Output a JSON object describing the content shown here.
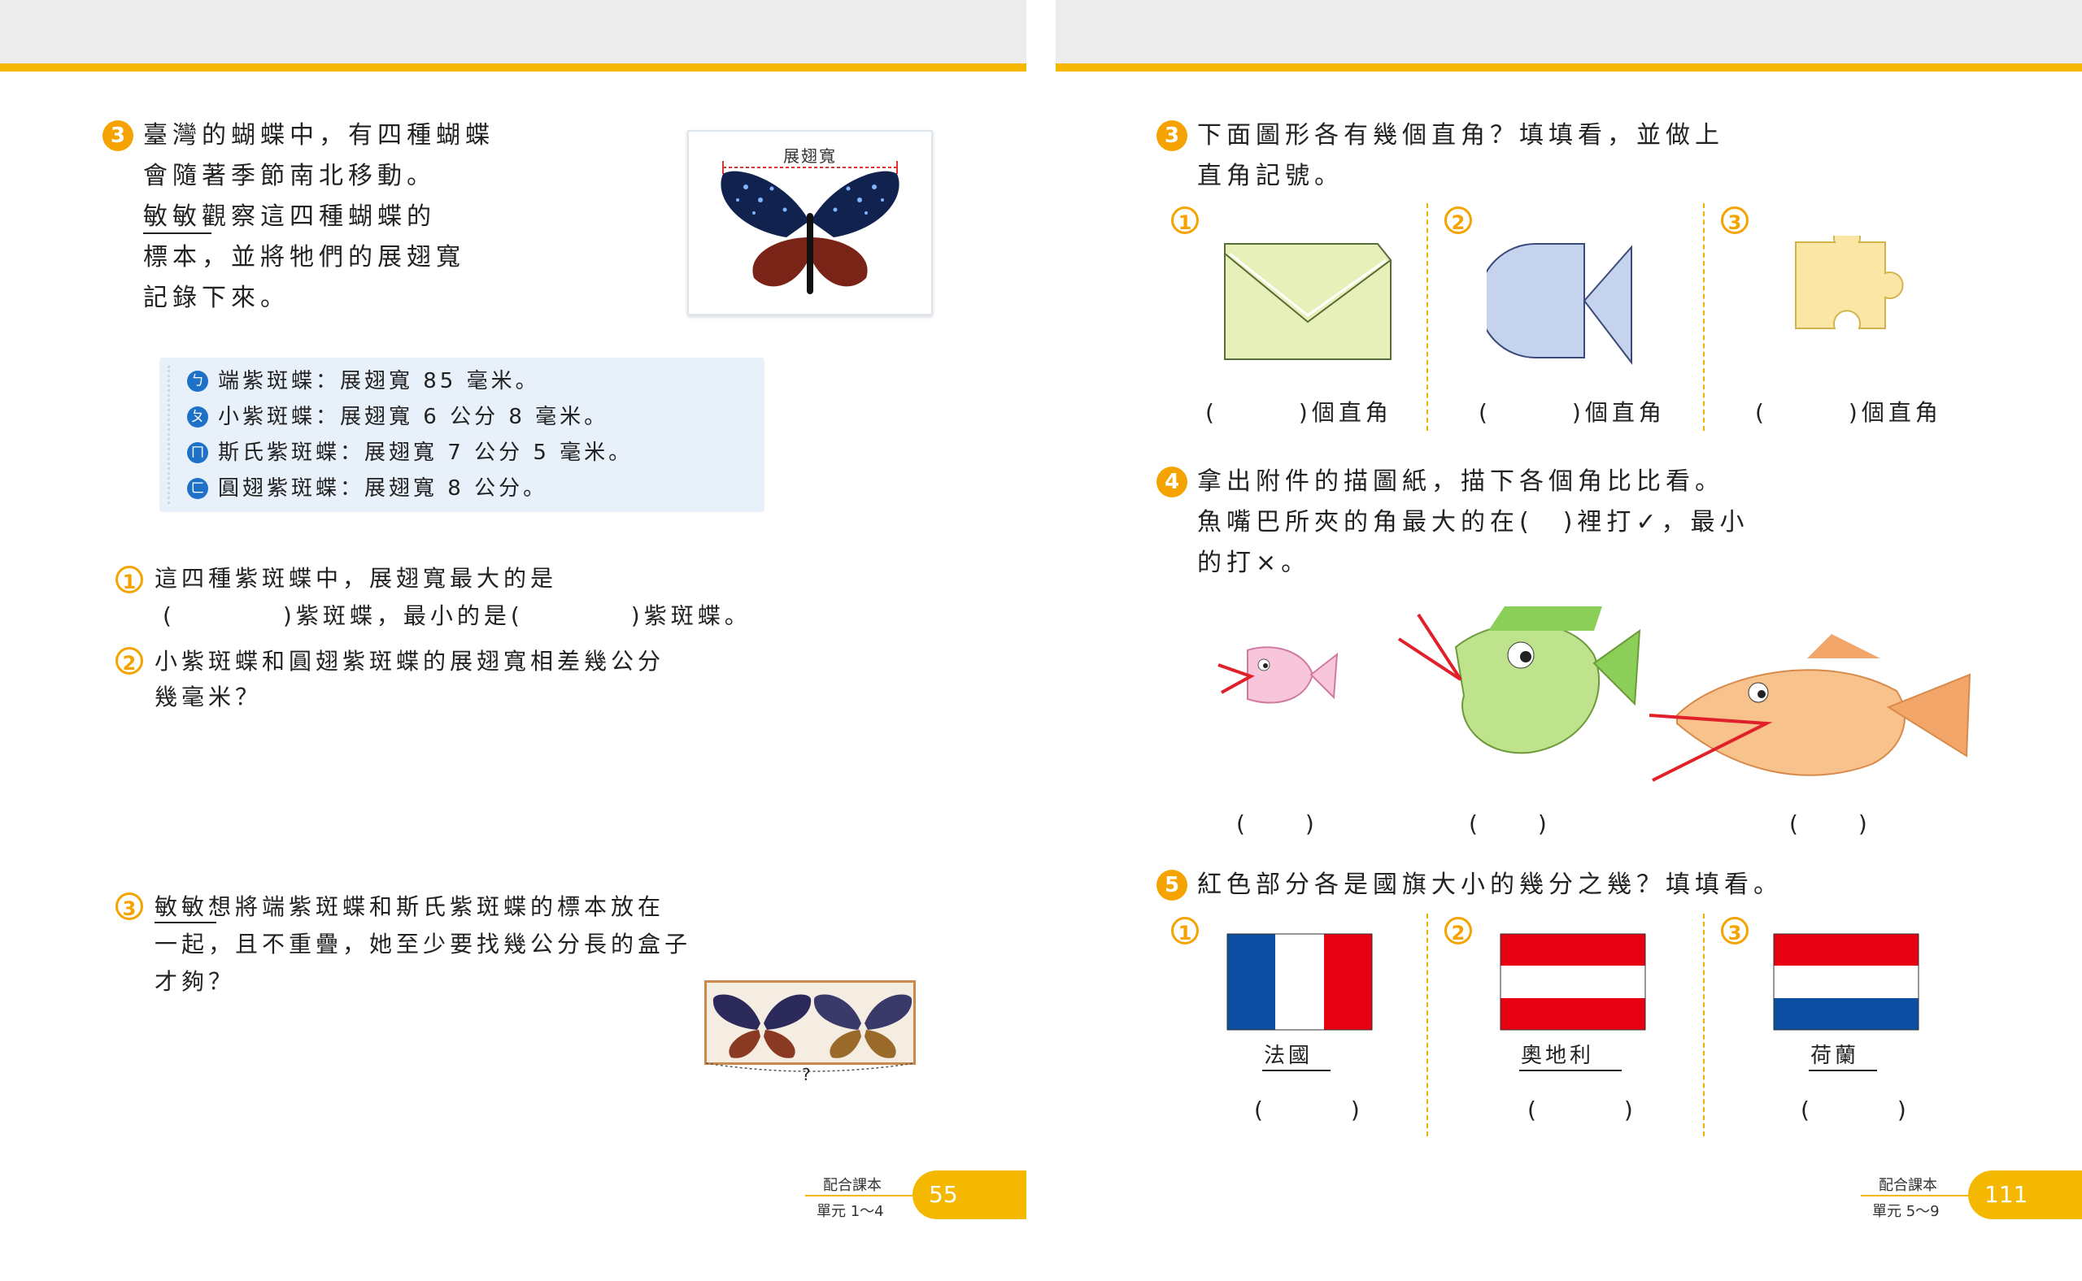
{
  "left": {
    "q3": {
      "num": "3",
      "line1": "臺灣的蝴蝶中，有四種蝴蝶",
      "line2": "會隨著季節南北移動。",
      "line3": "敏敏觀察這四種蝴蝶的",
      "line4": "標本，並將牠們的展翅寬",
      "line5": "記錄下來。"
    },
    "photo_label": "展翅寬",
    "panel": {
      "items": [
        {
          "bullet": "ㄅ",
          "text": "端紫斑蝶：展翅寬 85 毫米。"
        },
        {
          "bullet": "ㄆ",
          "text": "小紫斑蝶：展翅寬 6 公分 8 毫米。"
        },
        {
          "bullet": "ㄇ",
          "text": "斯氏紫斑蝶：展翅寬 7 公分 5 毫米。"
        },
        {
          "bullet": "ㄈ",
          "text": "圓翅紫斑蝶：展翅寬 8 公分。"
        }
      ]
    },
    "sub1": {
      "num": "1",
      "line1": "這四種紫斑蝶中，展翅寬最大的是",
      "line2": "(　　　　)紫斑蝶，最小的是(　　　　)紫斑蝶。"
    },
    "sub2": {
      "num": "2",
      "line1": "小紫斑蝶和圓翅紫斑蝶的展翅寬相差幾公分",
      "line2": "幾毫米？"
    },
    "sub3": {
      "num": "3",
      "line1": "敏敏想將端紫斑蝶和斯氏紫斑蝶的標本放在",
      "line2": "一起，且不重疊，她至少要找幾公分長的盒子",
      "line3": "才夠？"
    },
    "box_mark": "?",
    "footer": {
      "label1": "配合課本",
      "label2": "單元 1～4",
      "page": "55"
    }
  },
  "right": {
    "q3": {
      "num": "3",
      "line1": "下面圖形各有幾個直角？填填看，並做上",
      "line2": "直角記號。"
    },
    "shapes": [
      {
        "num": "1",
        "answer": "(　　　)個直角"
      },
      {
        "num": "2",
        "answer": "(　　　)個直角"
      },
      {
        "num": "3",
        "answer": "(　　　)個直角"
      }
    ],
    "q4": {
      "num": "4",
      "line1": "拿出附件的描圖紙，描下各個角比比看。",
      "line2": "魚嘴巴所夾的角最大的在(　)裡打✓，最小",
      "line3": "的打×。"
    },
    "fish_answers": [
      "(　　)",
      "(　　)",
      "(　　)"
    ],
    "q5": {
      "num": "5",
      "line1": "紅色部分各是國旗大小的幾分之幾？填填看。"
    },
    "flags": [
      {
        "num": "1",
        "name": "法國",
        "answer": "(　　　)"
      },
      {
        "num": "2",
        "name": "奧地利",
        "answer": "(　　　)"
      },
      {
        "num": "3",
        "name": "荷蘭",
        "answer": "(　　　)"
      }
    ],
    "footer": {
      "label1": "配合課本",
      "label2": "單元 5～9",
      "page": "111"
    }
  },
  "colors": {
    "accent_yellow": "#f5b800",
    "number_orange": "#f5a300",
    "flag_red": "#e60012",
    "flag_blue": "#0b4ea2",
    "panel_bg": "#e8f0fa"
  }
}
